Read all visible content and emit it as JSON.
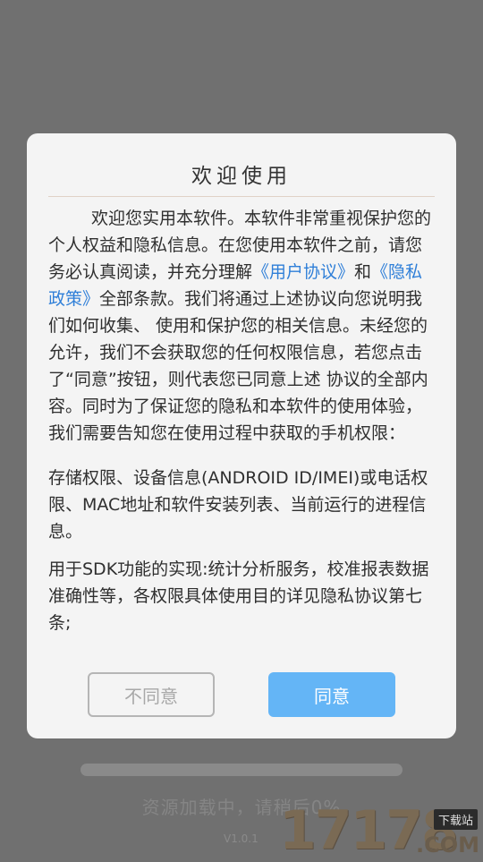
{
  "background": {
    "loading_text": "资源加载中，请稍后0%",
    "version": "V1.0.1"
  },
  "watermark": {
    "number": "17178",
    "tag": "下载站",
    "domain": ".COM"
  },
  "dialog": {
    "title": "欢迎使用",
    "intro": {
      "part1": "欢迎您实用本软件。本软件非常重视保护您的个人权益和隐私信息。在您使用本软件之前，请您务必认真阅读，并充分理解",
      "link_user_agreement": "《用户协议》",
      "and": "和",
      "link_privacy_policy": "《隐私政策》",
      "part2": "全部条款。我们将通过上述协议向您说明我们如何收集、 使用和保护您的相关信息。未经您的允许，我们不会获取您的任何权限信息，若您点击了“同意”按钮，则代表您已同意上述 协议的全部内容。同时为了保证您的隐私和本软件的使用体验，我们需要告知您在使用过程中获取的手机权限："
    },
    "permissions_text": "存储权限、设备信息(ANDROID ID/IMEI)或电话权限、MAC地址和软件安装列表、当前运行的进程信息。",
    "sdk_text": "用于SDK功能的实现:统计分析服务，校准报表数据准确性等，各权限具体使用目的详见隐私协议第七条;",
    "disagree_label": "不同意",
    "agree_label": "同意"
  },
  "colors": {
    "link": "#2f7fd8",
    "agree_button": "#64b5f6",
    "overlay": "#707070"
  }
}
